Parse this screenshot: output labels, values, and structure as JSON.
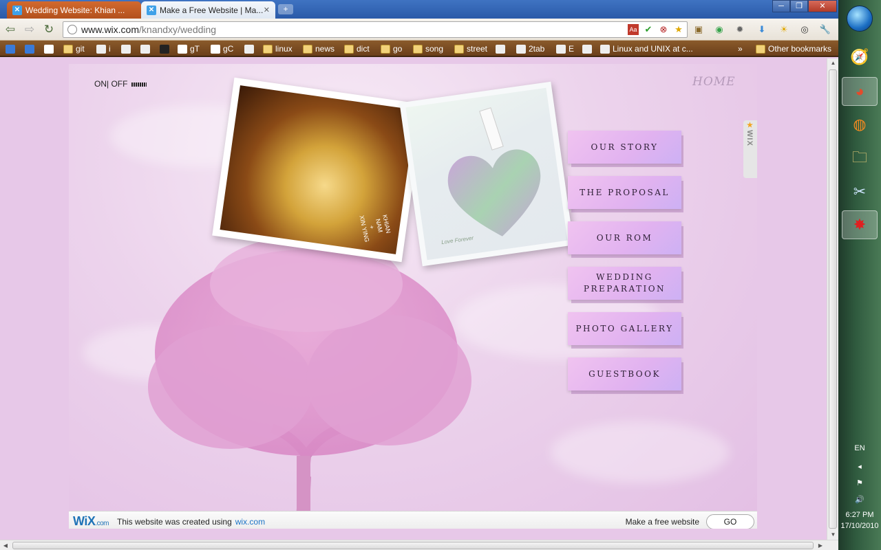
{
  "browser": {
    "tabs": [
      {
        "label": "Wedding Website: Khian ...",
        "active": false
      },
      {
        "label": "Make a Free Website | Ma...",
        "active": true
      }
    ],
    "url_host": "www.wix.com",
    "url_path": "/knandxy/wedding",
    "bookmarks": [
      {
        "label": "",
        "icon": "doc-icon"
      },
      {
        "label": "",
        "icon": "doc-icon"
      },
      {
        "label": "",
        "icon": "gmail-icon"
      },
      {
        "label": "git",
        "icon": "folder-icon"
      },
      {
        "label": "i",
        "icon": "page-icon"
      },
      {
        "label": "",
        "icon": "page-icon"
      },
      {
        "label": "",
        "icon": "page-icon"
      },
      {
        "label": "",
        "icon": "k-icon"
      },
      {
        "label": "gT",
        "icon": "google-icon"
      },
      {
        "label": "gC",
        "icon": "google-icon"
      },
      {
        "label": "",
        "icon": "page-icon"
      },
      {
        "label": "linux",
        "icon": "folder-icon"
      },
      {
        "label": "news",
        "icon": "folder-icon"
      },
      {
        "label": "dict",
        "icon": "folder-icon"
      },
      {
        "label": "go",
        "icon": "folder-icon"
      },
      {
        "label": "song",
        "icon": "folder-icon"
      },
      {
        "label": "street",
        "icon": "folder-icon"
      },
      {
        "label": "",
        "icon": "page-icon"
      },
      {
        "label": "2tab",
        "icon": "page-icon"
      },
      {
        "label": "E",
        "icon": "page-icon"
      },
      {
        "label": "",
        "icon": "page-icon"
      },
      {
        "label": "Linux and UNIX at c...",
        "icon": "page-icon"
      }
    ],
    "other_bookmarks": "Other bookmarks",
    "window_controls": {
      "min": "─",
      "max": "❐",
      "close": "✕"
    }
  },
  "page": {
    "audio_toggle": "ON| OFF",
    "home_link": "HOME",
    "photo1_caption": "KHIAN\nNAM\n+\nXIN YING",
    "photo2_caption": "Love Forever",
    "menu": [
      {
        "label": "OUR STORY"
      },
      {
        "label": "THE PROPOSAL"
      },
      {
        "label": "OUR ROM"
      },
      {
        "label": "WEDDING\nPREPARATION"
      },
      {
        "label": "PHOTO GALLERY"
      },
      {
        "label": "GUESTBOOK"
      }
    ],
    "side_tab": "WIX"
  },
  "wix_bar": {
    "logo": "WiX",
    "logo_suffix": ".com",
    "created_text": "This website was created using",
    "link_text": "wix.com",
    "free_text": "Make a free website",
    "go_label": "GO"
  },
  "taskbar": {
    "lang": "EN",
    "time": "6:27 PM",
    "date": "17/10/2010"
  },
  "colors": {
    "page_bg": "#e7c8e8",
    "menu_button": "#e1b2f0",
    "wix_blue": "#1f73b7"
  }
}
